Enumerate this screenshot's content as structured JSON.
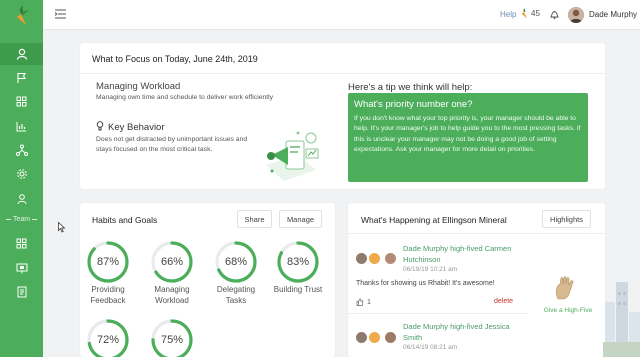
{
  "topbar": {
    "help_label": "Help",
    "carrot_count": "45",
    "user_name": "Dade Murphy"
  },
  "sidebar": {
    "team_label": "Team"
  },
  "focus": {
    "title": "What to Focus on Today, June 24th, 2019",
    "workload_title": "Managing Workload",
    "workload_sub": "Managing own time and schedule to deliver work efficiently",
    "behavior_title": "Key Behavior",
    "behavior_desc": "Does not get distracted by unimportant issues and stays focused on the most critical task.",
    "tip_heading": "Here's a tip we think will help:",
    "tip_title": "What's priority number one?",
    "tip_body": "If you don't know what your top priority is, your manager should be able to help. It's your manager's job to help guide you to the most pressing tasks. If this is unclear your manager may not be doing a good job of setting expectations. Ask your manager for more detail on priorities."
  },
  "habits": {
    "title": "Habits and Goals",
    "share_label": "Share",
    "manage_label": "Manage",
    "gauges": [
      {
        "value": "87%",
        "fraction": 0.87,
        "label1": "Providing",
        "label2": "Feedback"
      },
      {
        "value": "66%",
        "fraction": 0.66,
        "label1": "Managing",
        "label2": "Workload"
      },
      {
        "value": "68%",
        "fraction": 0.68,
        "label1": "Delegating",
        "label2": "Tasks"
      },
      {
        "value": "83%",
        "fraction": 0.83,
        "label1": "Building Trust",
        "label2": ""
      },
      {
        "value": "72%",
        "fraction": 0.72,
        "label1": "",
        "label2": ""
      },
      {
        "value": "75%",
        "fraction": 0.75,
        "label1": "",
        "label2": ""
      }
    ]
  },
  "whats": {
    "title": "What's Happening at Ellingson Mineral",
    "highlights_label": "Highlights",
    "give_high_five": "Give a High-Five",
    "items": [
      {
        "headline1": "Dade Murphy high-fived Carmen",
        "headline2": "Hutchinson",
        "date": "06/19/19 10:21 am",
        "message": "Thanks for showing us Rhabit! It's awesome!",
        "likes": "1",
        "delete": "delete"
      },
      {
        "headline1": "Dade Murphy high-fived Jessica",
        "headline2": "Smith",
        "date": "06/14/19 08:21 am",
        "message": "",
        "likes": "",
        "delete": ""
      }
    ]
  },
  "colors": {
    "brand_green": "#4cae5a",
    "gauge_track": "#e8ebee"
  }
}
